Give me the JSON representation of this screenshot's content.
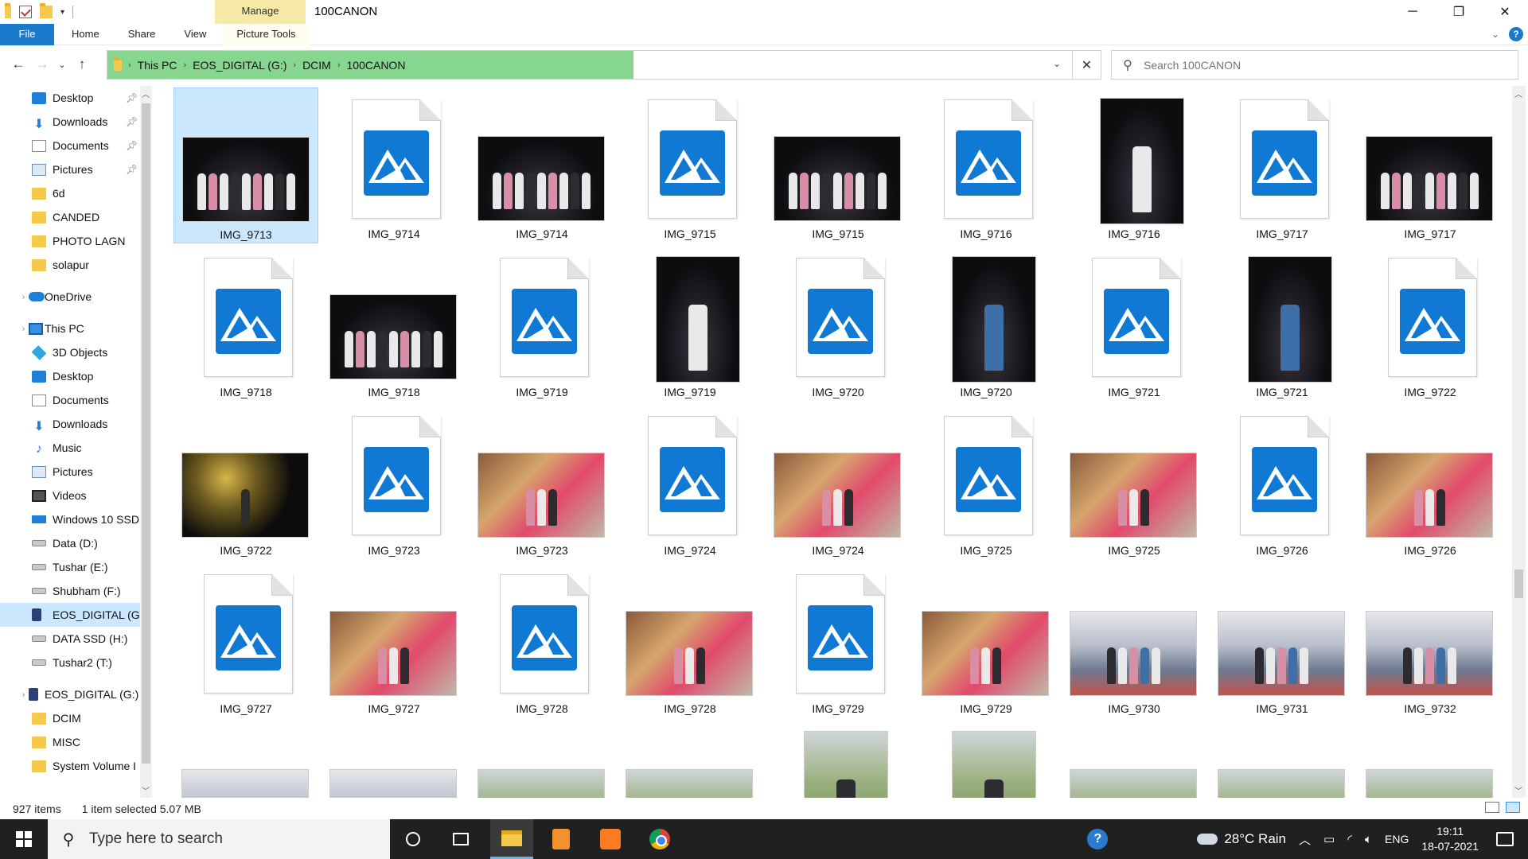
{
  "window": {
    "title": "100CANON",
    "context_tab": "Manage",
    "controls": {
      "minimize": "─",
      "restore": "❐",
      "close": "✕"
    }
  },
  "ribbon": {
    "tabs": [
      "File",
      "Home",
      "Share",
      "View",
      "Picture Tools"
    ],
    "help": "?"
  },
  "address": {
    "crumbs": [
      "This PC",
      "EOS_DIGITAL (G:)",
      "DCIM",
      "100CANON"
    ],
    "progress_fraction": 0.53,
    "progress_color": "#86d68f"
  },
  "search": {
    "placeholder": "Search 100CANON"
  },
  "nav": {
    "items": [
      {
        "label": "Desktop",
        "icon": "desktop-icon",
        "pinned": true
      },
      {
        "label": "Downloads",
        "icon": "download-icon",
        "pinned": true
      },
      {
        "label": "Documents",
        "icon": "documents-icon",
        "pinned": true
      },
      {
        "label": "Pictures",
        "icon": "pictures-icon",
        "pinned": true
      },
      {
        "label": "6d",
        "icon": "folder-icon"
      },
      {
        "label": "CANDED",
        "icon": "folder-icon"
      },
      {
        "label": "PHOTO  LAGN",
        "icon": "folder-icon"
      },
      {
        "label": "solapur",
        "icon": "folder-icon"
      },
      {
        "label": "OneDrive",
        "icon": "onedrive-icon"
      },
      {
        "label": "This PC",
        "icon": "this-pc-icon"
      },
      {
        "label": "3D Objects",
        "icon": "3d-objects-icon"
      },
      {
        "label": "Desktop",
        "icon": "desktop-icon"
      },
      {
        "label": "Documents",
        "icon": "documents-icon"
      },
      {
        "label": "Downloads",
        "icon": "download-icon"
      },
      {
        "label": "Music",
        "icon": "music-icon"
      },
      {
        "label": "Pictures",
        "icon": "pictures-icon"
      },
      {
        "label": "Videos",
        "icon": "videos-icon"
      },
      {
        "label": "Windows 10 SSD",
        "icon": "windows-drive-icon"
      },
      {
        "label": "Data (D:)",
        "icon": "drive-icon"
      },
      {
        "label": "Tushar (E:)",
        "icon": "drive-icon"
      },
      {
        "label": "Shubham (F:)",
        "icon": "drive-icon"
      },
      {
        "label": "EOS_DIGITAL (G:",
        "icon": "sd-card-icon",
        "selected": true
      },
      {
        "label": "DATA SSD (H:)",
        "icon": "drive-icon"
      },
      {
        "label": "Tushar2 (T:)",
        "icon": "drive-icon"
      },
      {
        "label": "EOS_DIGITAL (G:)",
        "icon": "sd-card-icon"
      },
      {
        "label": "DCIM",
        "icon": "folder-icon"
      },
      {
        "label": "MISC",
        "icon": "folder-icon"
      },
      {
        "label": "System Volume I",
        "icon": "folder-icon"
      }
    ]
  },
  "files": [
    {
      "name": "IMG_9713",
      "kind": "photo",
      "style": "night",
      "selected": true
    },
    {
      "name": "IMG_9714",
      "kind": "generic"
    },
    {
      "name": "IMG_9714",
      "kind": "photo",
      "style": "night"
    },
    {
      "name": "IMG_9715",
      "kind": "generic"
    },
    {
      "name": "IMG_9715",
      "kind": "photo",
      "style": "night"
    },
    {
      "name": "IMG_9716",
      "kind": "generic"
    },
    {
      "name": "IMG_9716",
      "kind": "photo",
      "style": "night",
      "tall": true
    },
    {
      "name": "IMG_9717",
      "kind": "generic"
    },
    {
      "name": "IMG_9717",
      "kind": "photo",
      "style": "night"
    },
    {
      "name": "IMG_9718",
      "kind": "generic"
    },
    {
      "name": "IMG_9718",
      "kind": "photo",
      "style": "night"
    },
    {
      "name": "IMG_9719",
      "kind": "generic"
    },
    {
      "name": "IMG_9719",
      "kind": "photo",
      "style": "night",
      "tall": true
    },
    {
      "name": "IMG_9720",
      "kind": "generic"
    },
    {
      "name": "IMG_9720",
      "kind": "photo",
      "style": "night",
      "tall": true
    },
    {
      "name": "IMG_9721",
      "kind": "generic"
    },
    {
      "name": "IMG_9721",
      "kind": "photo",
      "style": "night",
      "tall": true
    },
    {
      "name": "IMG_9722",
      "kind": "generic"
    },
    {
      "name": "IMG_9722",
      "kind": "photo",
      "style": "yellow"
    },
    {
      "name": "IMG_9723",
      "kind": "generic"
    },
    {
      "name": "IMG_9723",
      "kind": "photo",
      "style": "wedding"
    },
    {
      "name": "IMG_9724",
      "kind": "generic"
    },
    {
      "name": "IMG_9724",
      "kind": "photo",
      "style": "wedding"
    },
    {
      "name": "IMG_9725",
      "kind": "generic"
    },
    {
      "name": "IMG_9725",
      "kind": "photo",
      "style": "wedding"
    },
    {
      "name": "IMG_9726",
      "kind": "generic"
    },
    {
      "name": "IMG_9726",
      "kind": "photo",
      "style": "wedding"
    },
    {
      "name": "IMG_9727",
      "kind": "generic"
    },
    {
      "name": "IMG_9727",
      "kind": "photo",
      "style": "wedding"
    },
    {
      "name": "IMG_9728",
      "kind": "generic"
    },
    {
      "name": "IMG_9728",
      "kind": "photo",
      "style": "wedding"
    },
    {
      "name": "IMG_9729",
      "kind": "generic"
    },
    {
      "name": "IMG_9729",
      "kind": "photo",
      "style": "wedding"
    },
    {
      "name": "IMG_9730",
      "kind": "photo",
      "style": "crowd"
    },
    {
      "name": "IMG_9731",
      "kind": "photo",
      "style": "crowd"
    },
    {
      "name": "IMG_9732",
      "kind": "photo",
      "style": "crowd"
    },
    {
      "name": "",
      "kind": "photo",
      "style": "crowd"
    },
    {
      "name": "",
      "kind": "photo",
      "style": "crowd"
    },
    {
      "name": "",
      "kind": "photo",
      "style": "field"
    },
    {
      "name": "",
      "kind": "photo",
      "style": "field"
    },
    {
      "name": "",
      "kind": "photo",
      "style": "field",
      "tall": true
    },
    {
      "name": "",
      "kind": "photo",
      "style": "field",
      "tall": true
    },
    {
      "name": "",
      "kind": "photo",
      "style": "field"
    },
    {
      "name": "",
      "kind": "photo",
      "style": "field"
    },
    {
      "name": "",
      "kind": "photo",
      "style": "field"
    }
  ],
  "status": {
    "count": "927 items",
    "selection": "1 item selected  5.07 MB"
  },
  "taskbar": {
    "search_placeholder": "Type here to search",
    "weather": "28°C  Rain",
    "language": "ENG",
    "time": "19:11",
    "date": "18-07-2021"
  }
}
